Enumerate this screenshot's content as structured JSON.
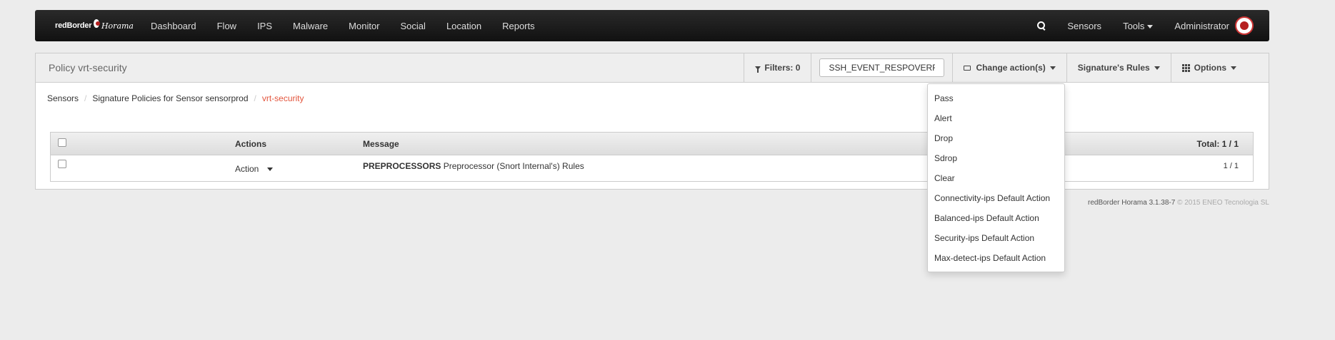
{
  "navbar": {
    "brand_text": "redBorder",
    "brand_sub": "Horama",
    "items": [
      "Dashboard",
      "Flow",
      "IPS",
      "Malware",
      "Monitor",
      "Social",
      "Location",
      "Reports"
    ],
    "sensors": "Sensors",
    "tools": "Tools",
    "user": "Administrator"
  },
  "panel": {
    "title": "Policy vrt-security",
    "filters_label": "Filters: 0",
    "search_value": "SSH_EVENT_RESPOVERFLOW",
    "change_actions_label": "Change action(s)",
    "signature_rules_label": "Signature's Rules",
    "options_label": "Options"
  },
  "breadcrumb": {
    "items": [
      "Sensors",
      "Signature Policies for Sensor sensorprod"
    ],
    "active": "vrt-security"
  },
  "table": {
    "headers": {
      "actions": "Actions",
      "message": "Message",
      "total": "Total: 1 / 1"
    },
    "rows": [
      {
        "action": "Action",
        "message_strong": "PREPROCESSORS",
        "message": "Preprocessor (Snort Internal's) Rules",
        "count": "1 / 1"
      }
    ]
  },
  "footer": {
    "product": "redBorder Horama 3.1.38-7",
    "copyright": "© 2015 ENEO Tecnologia SL"
  },
  "dropdown": {
    "items": [
      "Pass",
      "Alert",
      "Drop",
      "Sdrop",
      "Clear",
      "Connectivity-ips Default Action",
      "Balanced-ips Default Action",
      "Security-ips Default Action",
      "Max-detect-ips Default Action"
    ]
  }
}
